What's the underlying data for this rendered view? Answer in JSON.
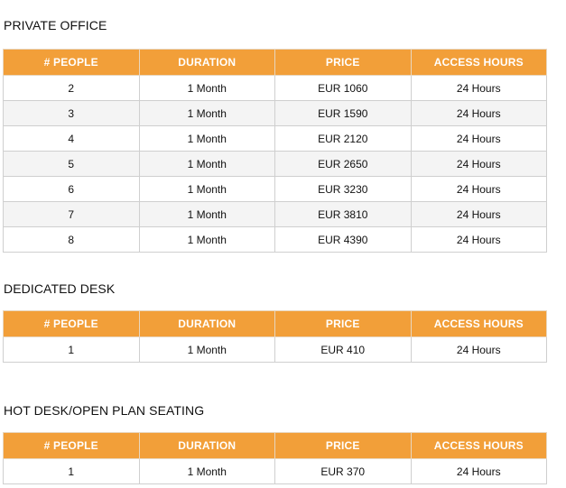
{
  "columns": [
    "# PEOPLE",
    "DURATION",
    "PRICE",
    "ACCESS HOURS"
  ],
  "private_office": {
    "title": "PRIVATE OFFICE",
    "rows": [
      [
        "2",
        "1 Month",
        "EUR 1060",
        "24 Hours"
      ],
      [
        "3",
        "1 Month",
        "EUR 1590",
        "24 Hours"
      ],
      [
        "4",
        "1 Month",
        "EUR 2120",
        "24 Hours"
      ],
      [
        "5",
        "1 Month",
        "EUR 2650",
        "24 Hours"
      ],
      [
        "6",
        "1 Month",
        "EUR 3230",
        "24 Hours"
      ],
      [
        "7",
        "1 Month",
        "EUR 3810",
        "24 Hours"
      ],
      [
        "8",
        "1 Month",
        "EUR 4390",
        "24 Hours"
      ]
    ]
  },
  "dedicated_desk": {
    "title": "DEDICATED DESK",
    "rows": [
      [
        "1",
        "1 Month",
        "EUR 410",
        "24 Hours"
      ]
    ]
  },
  "hot_desk": {
    "title": "HOT DESK/OPEN PLAN SEATING",
    "rows": [
      [
        "1",
        "1 Month",
        "EUR 370",
        "24 Hours"
      ]
    ]
  },
  "colors": {
    "header_bg": "#f29f39",
    "header_text": "#ffffff",
    "alt_row_bg": "#f4f4f4",
    "border": "#cfcfcf"
  }
}
